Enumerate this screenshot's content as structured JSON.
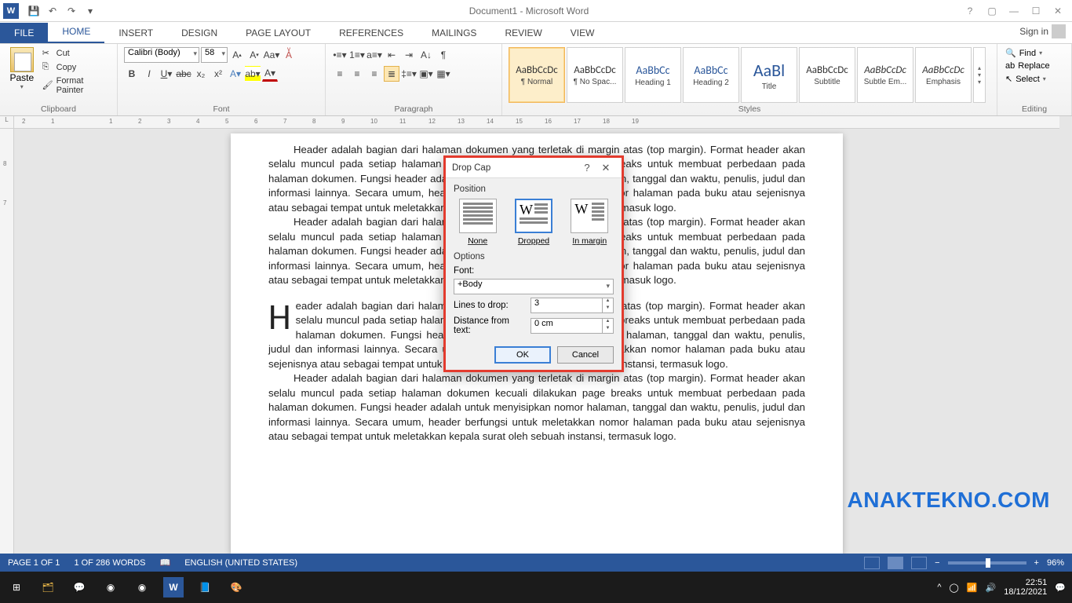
{
  "title": "Document1 - Microsoft Word",
  "qat": {
    "save": "💾",
    "undo": "↶",
    "redo": "↷"
  },
  "win": {
    "help": "?",
    "ribbon_opts": "▢",
    "min": "—",
    "max": "☐",
    "close": "✕"
  },
  "tabs": {
    "file": "FILE",
    "home": "HOME",
    "insert": "INSERT",
    "design": "DESIGN",
    "layout": "PAGE LAYOUT",
    "references": "REFERENCES",
    "mailings": "MAILINGS",
    "review": "REVIEW",
    "view": "VIEW"
  },
  "signin": "Sign in",
  "groups": {
    "clipboard": {
      "label": "Clipboard",
      "paste": "Paste",
      "cut": "Cut",
      "copy": "Copy",
      "painter": "Format Painter"
    },
    "font": {
      "label": "Font",
      "name": "Calibri (Body)",
      "size": "58"
    },
    "paragraph": {
      "label": "Paragraph"
    },
    "styles": {
      "label": "Styles",
      "items": [
        {
          "name": "¶ Normal",
          "sel": true,
          "cls": ""
        },
        {
          "name": "¶ No Spac...",
          "cls": ""
        },
        {
          "name": "Heading 1",
          "cls": "blue"
        },
        {
          "name": "Heading 2",
          "cls": "blue"
        },
        {
          "name": "Title",
          "cls": "big"
        },
        {
          "name": "Subtitle",
          "cls": ""
        },
        {
          "name": "Subtle Em...",
          "cls": "ital"
        },
        {
          "name": "Emphasis",
          "cls": "ital"
        }
      ],
      "preview": "AaBbCcDc",
      "preview_title": "AaBl",
      "preview_h": "AaBbCc"
    },
    "editing": {
      "label": "Editing",
      "find": "Find",
      "replace": "Replace",
      "select": "Select"
    }
  },
  "dialog": {
    "title": "Drop Cap",
    "position_label": "Position",
    "none": "None",
    "dropped": "Dropped",
    "margin": "In margin",
    "options_label": "Options",
    "font_label": "Font:",
    "font_value": "+Body",
    "lines_label": "Lines to drop:",
    "lines_value": "3",
    "dist_label": "Distance from text:",
    "dist_value": "0 cm",
    "ok": "OK",
    "cancel": "Cancel"
  },
  "doc": {
    "p1": "Header adalah bagian dari halaman dokumen yang terletak di margin atas (top margin). Format header akan selalu muncul pada setiap halaman dokumen kecuali dilakukan page breaks untuk membuat perbedaan pada halaman dokumen. Fungsi header adalah untuk menyisipkan nomor halaman, tanggal dan waktu, penulis, judul dan informasi lainnya. Secara umum, header berfungsi untuk meletakkan nomor halaman pada buku atau sejenisnya atau sebagai tempat untuk meletakkan kepala surat oleh sebuah instansi, termasuk logo.",
    "p2": "Header adalah bagian dari halaman dokumen yang terletak di margin atas (top margin). Format header akan selalu muncul pada setiap halaman dokumen kecuali dilakukan page breaks untuk membuat perbedaan pada halaman dokumen. Fungsi header adalah untuk menyisipkan nomor halaman, tanggal dan waktu, penulis, judul dan informasi lainnya. Secara umum, header berfungsi untuk meletakkan nomor halaman pada buku atau sejenisnya atau sebagai tempat untuk meletakkan kepala surat oleh sebuah instansi, termasuk logo.",
    "drop_letter": "H",
    "p3": "eader adalah bagian dari halaman dokumen yang terletak di margin atas (top margin). Format header akan selalu muncul pada setiap halaman dokumen kecuali dilakukan page breaks untuk membuat perbedaan pada halaman dokumen. Fungsi header adalah untuk menyisipkan nomor halaman, tanggal dan waktu, penulis, judul dan informasi lainnya. Secara umum, header berfungsi untuk meletakkan nomor halaman pada buku atau sejenisnya atau sebagai tempat untuk meletakkan kepala surat oleh sebuah instansi, termasuk logo.",
    "p4": "Header adalah bagian dari halaman dokumen yang terletak di margin atas (top margin). Format header akan selalu muncul pada setiap halaman dokumen kecuali dilakukan page breaks untuk membuat perbedaan pada halaman dokumen. Fungsi header adalah untuk menyisipkan nomor halaman, tanggal dan waktu, penulis, judul dan informasi lainnya. Secara umum, header berfungsi untuk meletakkan nomor halaman pada buku atau sejenisnya atau sebagai tempat untuk meletakkan kepala surat oleh sebuah instansi, termasuk logo."
  },
  "status": {
    "page": "PAGE 1 OF 1",
    "words": "1 OF 286 WORDS",
    "lang": "ENGLISH (UNITED STATES)",
    "zoom": "96%"
  },
  "watermark": "ANAKTEKNO.COM",
  "taskbar_time": "22:51",
  "taskbar_date": "18/12/2021",
  "ruler_ticks": [
    "2",
    "1",
    "",
    "1",
    "2",
    "3",
    "4",
    "5",
    "6",
    "7",
    "8",
    "9",
    "10",
    "11",
    "12",
    "13",
    "14",
    "15",
    "16",
    "17",
    "18",
    "19"
  ]
}
